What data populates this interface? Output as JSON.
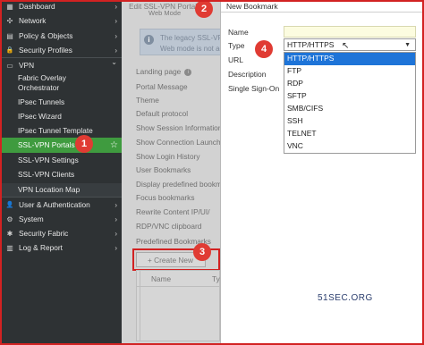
{
  "sidebar": {
    "items": [
      {
        "label": "Dashboard",
        "icon": "dashboard-icon",
        "glyph": "▦"
      },
      {
        "label": "Network",
        "icon": "network-icon",
        "glyph": "✣"
      },
      {
        "label": "Policy & Objects",
        "icon": "policy-icon",
        "glyph": "▤"
      },
      {
        "label": "Security Profiles",
        "icon": "lock-icon",
        "glyph": "🔒"
      },
      {
        "label": "VPN",
        "icon": "monitor-icon",
        "glyph": "▭"
      },
      {
        "label": "User & Authentication",
        "icon": "user-icon",
        "glyph": "👤"
      },
      {
        "label": "System",
        "icon": "gear-icon",
        "glyph": "⚙"
      },
      {
        "label": "Security Fabric",
        "icon": "fabric-icon",
        "glyph": "✱"
      },
      {
        "label": "Log & Report",
        "icon": "chart-icon",
        "glyph": "▥"
      }
    ],
    "vpn_sub": [
      {
        "label_1": "Fabric Overlay",
        "label_2": "Orchestrator"
      },
      {
        "label": "IPsec Tunnels"
      },
      {
        "label": "IPsec Wizard"
      },
      {
        "label": "IPsec Tunnel Template"
      },
      {
        "label": "SSL-VPN Portals"
      },
      {
        "label": "SSL-VPN Settings"
      },
      {
        "label": "SSL-VPN Clients"
      },
      {
        "label": "VPN Location Map"
      }
    ],
    "chevron_right": "›",
    "chevron_down": "⌄",
    "star": "☆"
  },
  "middle": {
    "title": "Edit SSL-VPN Portal",
    "subtitle": "Web Mode",
    "legacy_line1": "The legacy SSL-VP",
    "legacy_line2": "Web mode is not accessi",
    "legacy_icon": "i",
    "rows": [
      "Landing page",
      "Portal Message",
      "Theme",
      "Default protocol",
      "Show Session Information",
      "Show Connection Launcher",
      "Show Login History",
      "User Bookmarks",
      "Display predefined bookmarks",
      "Focus bookmarks",
      "Rewrite Content IP/UI/",
      "RDP/VNC clipboard",
      "Predefined Bookmarks"
    ],
    "info_glyph": "i",
    "create_label": "+ Create New",
    "table_headers": [
      "Name",
      "Ty"
    ]
  },
  "dialog": {
    "title": "New Bookmark",
    "labels": {
      "name": "Name",
      "type": "Type",
      "url": "URL",
      "description": "Description",
      "sso": "Single Sign-On"
    },
    "name_value": "",
    "type_value": "HTTP/HTTPS",
    "options": [
      "HTTP/HTTPS",
      "FTP",
      "RDP",
      "SFTP",
      "SMB/CIFS",
      "SSH",
      "TELNET",
      "VNC"
    ],
    "selected_index": 0,
    "select_arrow": "▼",
    "cursor": "↖"
  },
  "watermark": "51SEC.ORG",
  "badges": [
    "1",
    "2",
    "3",
    "4"
  ],
  "colors": {
    "sidebar_bg": "#2e3234",
    "active": "#3f9b3f",
    "badge": "#e03b33",
    "option_selected": "#1e74d8",
    "frame": "#d22222"
  }
}
